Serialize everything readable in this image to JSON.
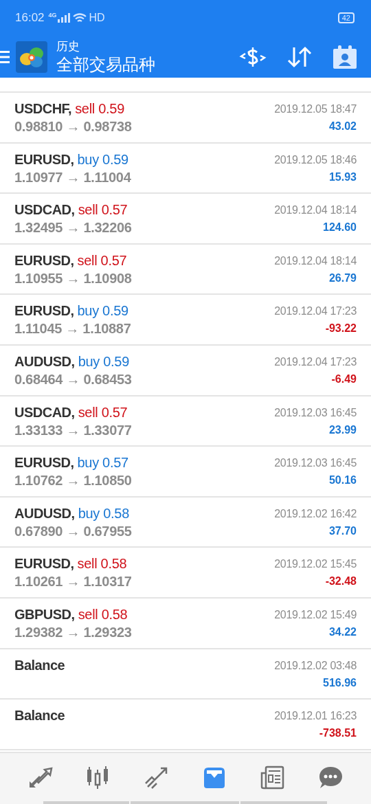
{
  "status_bar": {
    "time": "16:02",
    "network": "4G",
    "hd": "HD",
    "battery": "42"
  },
  "toolbar": {
    "title": "历史",
    "subtitle": "全部交易品种"
  },
  "deals": [
    {
      "kind": "trade",
      "symbol": "USDCHF,",
      "sell": true,
      "action": "sell 0.59",
      "prices": "0.98810 → 0.98738",
      "time": "2019.12.05 18:47",
      "profit": "43.02",
      "positive": true
    },
    {
      "kind": "trade",
      "symbol": "EURUSD,",
      "sell": false,
      "action": "buy 0.59",
      "prices": "1.10977 → 1.11004",
      "time": "2019.12.05 18:46",
      "profit": "15.93",
      "positive": true
    },
    {
      "kind": "trade",
      "symbol": "USDCAD,",
      "sell": true,
      "action": "sell 0.57",
      "prices": "1.32495 → 1.32206",
      "time": "2019.12.04 18:14",
      "profit": "124.60",
      "positive": true
    },
    {
      "kind": "trade",
      "symbol": "EURUSD,",
      "sell": true,
      "action": "sell 0.57",
      "prices": "1.10955 → 1.10908",
      "time": "2019.12.04 18:14",
      "profit": "26.79",
      "positive": true
    },
    {
      "kind": "trade",
      "symbol": "EURUSD,",
      "sell": false,
      "action": "buy 0.59",
      "prices": "1.11045 → 1.10887",
      "time": "2019.12.04 17:23",
      "profit": "-93.22",
      "positive": false
    },
    {
      "kind": "trade",
      "symbol": "AUDUSD,",
      "sell": false,
      "action": "buy 0.59",
      "prices": "0.68464 → 0.68453",
      "time": "2019.12.04 17:23",
      "profit": "-6.49",
      "positive": false
    },
    {
      "kind": "trade",
      "symbol": "USDCAD,",
      "sell": true,
      "action": "sell 0.57",
      "prices": "1.33133 → 1.33077",
      "time": "2019.12.03 16:45",
      "profit": "23.99",
      "positive": true
    },
    {
      "kind": "trade",
      "symbol": "EURUSD,",
      "sell": false,
      "action": "buy 0.57",
      "prices": "1.10762 → 1.10850",
      "time": "2019.12.03 16:45",
      "profit": "50.16",
      "positive": true
    },
    {
      "kind": "trade",
      "symbol": "AUDUSD,",
      "sell": false,
      "action": "buy 0.58",
      "prices": "0.67890 → 0.67955",
      "time": "2019.12.02 16:42",
      "profit": "37.70",
      "positive": true
    },
    {
      "kind": "trade",
      "symbol": "EURUSD,",
      "sell": true,
      "action": "sell 0.58",
      "prices": "1.10261 → 1.10317",
      "time": "2019.12.02 15:45",
      "profit": "-32.48",
      "positive": false
    },
    {
      "kind": "trade",
      "symbol": "GBPUSD,",
      "sell": true,
      "action": "sell 0.58",
      "prices": "1.29382 → 1.29323",
      "time": "2019.12.02 15:49",
      "profit": "34.22",
      "positive": true
    },
    {
      "kind": "balance",
      "symbol": "Balance",
      "time": "2019.12.02 03:48",
      "profit": "516.96",
      "positive": true
    },
    {
      "kind": "balance",
      "symbol": "Balance",
      "time": "2019.12.01 16:23",
      "profit": "-738.51",
      "positive": false
    }
  ],
  "bottom_nav": [
    {
      "kind": "quotes",
      "selected": false
    },
    {
      "kind": "chart",
      "selected": false
    },
    {
      "kind": "trade",
      "selected": false
    },
    {
      "kind": "history",
      "selected": true
    },
    {
      "kind": "news",
      "selected": false
    },
    {
      "kind": "chat",
      "selected": false
    }
  ]
}
